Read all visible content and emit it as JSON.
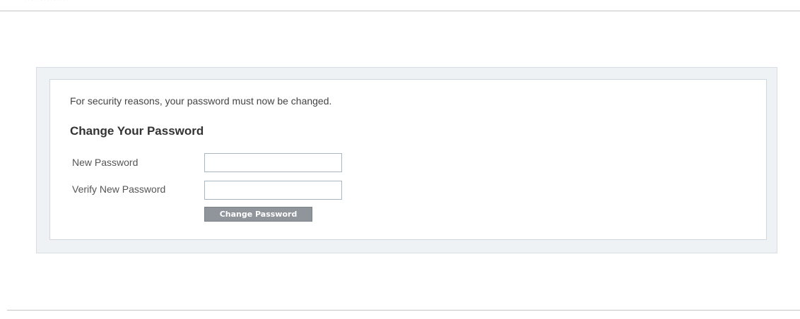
{
  "header": {
    "faded_text": "··· ··········"
  },
  "form": {
    "notice": "For security reasons, your password must now be changed.",
    "heading": "Change Your Password",
    "fields": {
      "new_password": {
        "label": "New Password",
        "value": "",
        "placeholder": ""
      },
      "verify_password": {
        "label": "Verify New Password",
        "value": "",
        "placeholder": ""
      }
    },
    "submit_label": "Change Password"
  },
  "colors": {
    "outer_panel_bg": "#eef2f5",
    "inner_panel_bg": "#ffffff",
    "input_border": "#a9b7c4",
    "button_bg": "#8f959a",
    "rule": "#c4c4c4"
  }
}
